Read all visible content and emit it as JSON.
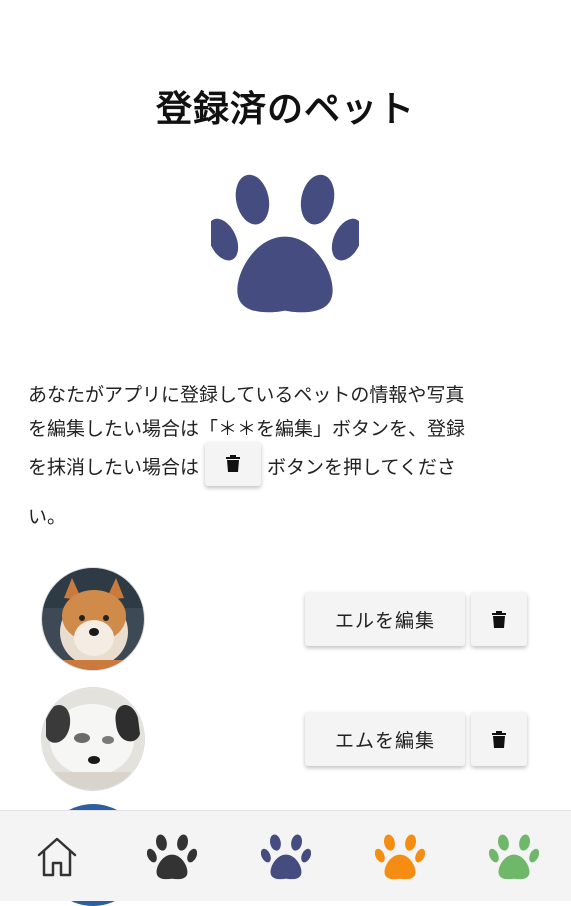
{
  "page": {
    "title": "登録済のペット"
  },
  "description": {
    "line1": "あなたがアプリに登録しているペットの情報や写真",
    "line2": "を編集したい場合は「＊＊を編集」ボタンを、登録",
    "line3_before": "を抹消したい場合は",
    "line3_after": "ボタンを押してくださ",
    "line4": "い。"
  },
  "pets": [
    {
      "edit_label": "エルを編集",
      "avatar": "shiba-inu-photo"
    },
    {
      "edit_label": "エムを編集",
      "avatar": "white-dog-photo"
    }
  ],
  "colors": {
    "hero_paw": "#444c80",
    "nav_paw_black": "#333333",
    "nav_paw_navy": "#444c80",
    "nav_paw_orange": "#f58d12",
    "nav_paw_green": "#6fb86a"
  },
  "icons": {
    "hero": "paw-icon",
    "delete": "trash-icon",
    "nav": [
      "home-icon",
      "paw-icon-black",
      "paw-icon-navy",
      "paw-icon-orange",
      "paw-icon-green"
    ]
  }
}
